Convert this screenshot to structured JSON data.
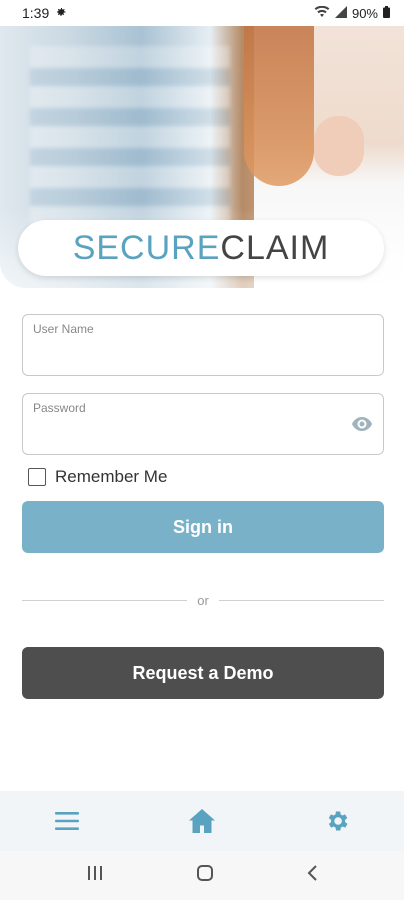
{
  "status": {
    "time": "1:39",
    "battery": "90%"
  },
  "logo": {
    "part1": "SECURE",
    "part2": "CLAIM"
  },
  "login": {
    "username_label": "User Name",
    "username_value": "",
    "password_label": "Password",
    "password_value": "",
    "remember_label": "Remember Me",
    "signin_label": "Sign in",
    "or_label": "or",
    "demo_label": "Request a Demo"
  },
  "bottom_nav": {
    "items": [
      {
        "icon": "menu-icon"
      },
      {
        "icon": "home-icon"
      },
      {
        "icon": "settings-icon"
      }
    ]
  },
  "system_nav": {
    "items": [
      "recent-apps",
      "home",
      "back"
    ]
  },
  "colors": {
    "accent": "#79b2c8",
    "dark_button": "#4e4e4e",
    "nav_icon": "#5aa3c0"
  }
}
